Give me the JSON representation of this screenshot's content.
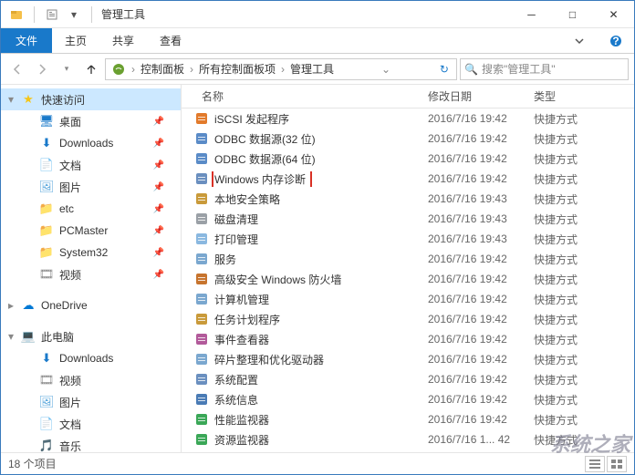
{
  "window": {
    "title": "管理工具",
    "min": "─",
    "max": "□",
    "close": "✕"
  },
  "ribbon": {
    "file": "文件",
    "tabs": [
      "主页",
      "共享",
      "查看"
    ]
  },
  "nav": {
    "history_dd": "▾",
    "up": "↑"
  },
  "breadcrumb": [
    "控制面板",
    "所有控制面板项",
    "管理工具"
  ],
  "search": {
    "placeholder": "搜索\"管理工具\""
  },
  "sidebar": [
    {
      "label": "快速访问",
      "icon": "star",
      "level": 1,
      "active": true,
      "exp": "▾"
    },
    {
      "label": "桌面",
      "icon": "desktop",
      "level": 2,
      "pin": true
    },
    {
      "label": "Downloads",
      "icon": "download",
      "level": 2,
      "pin": true
    },
    {
      "label": "文档",
      "icon": "doc",
      "level": 2,
      "pin": true
    },
    {
      "label": "图片",
      "icon": "pic",
      "level": 2,
      "pin": true
    },
    {
      "label": "etc",
      "icon": "folder",
      "level": 2,
      "pin": true
    },
    {
      "label": "PCMaster",
      "icon": "folder",
      "level": 2,
      "pin": true
    },
    {
      "label": "System32",
      "icon": "folder",
      "level": 2,
      "pin": true
    },
    {
      "label": "视频",
      "icon": "video",
      "level": 2,
      "pin": true
    },
    {
      "label": "",
      "spacer": true
    },
    {
      "label": "OneDrive",
      "icon": "onedrive",
      "level": 1,
      "exp": "▸"
    },
    {
      "label": "",
      "spacer": true
    },
    {
      "label": "此电脑",
      "icon": "pc",
      "level": 1,
      "exp": "▾"
    },
    {
      "label": "Downloads",
      "icon": "download",
      "level": 2
    },
    {
      "label": "视频",
      "icon": "video",
      "level": 2
    },
    {
      "label": "图片",
      "icon": "pic",
      "level": 2
    },
    {
      "label": "文档",
      "icon": "doc",
      "level": 2
    },
    {
      "label": "音乐",
      "icon": "music",
      "level": 2
    }
  ],
  "columns": {
    "name": "名称",
    "date": "修改日期",
    "type": "类型"
  },
  "files": [
    {
      "name": "iSCSI 发起程序",
      "date": "2016/7/16 19:42",
      "type": "快捷方式",
      "icon": "#e27a2b"
    },
    {
      "name": "ODBC 数据源(32 位)",
      "date": "2016/7/16 19:42",
      "type": "快捷方式",
      "icon": "#5a8bc7"
    },
    {
      "name": "ODBC 数据源(64 位)",
      "date": "2016/7/16 19:42",
      "type": "快捷方式",
      "icon": "#5a8bc7"
    },
    {
      "name": "Windows 内存诊断",
      "date": "2016/7/16 19:42",
      "type": "快捷方式",
      "icon": "#6a8fbf",
      "highlight": true
    },
    {
      "name": "本地安全策略",
      "date": "2016/7/16 19:43",
      "type": "快捷方式",
      "icon": "#c99a3a"
    },
    {
      "name": "磁盘清理",
      "date": "2016/7/16 19:43",
      "type": "快捷方式",
      "icon": "#9aa0a6"
    },
    {
      "name": "打印管理",
      "date": "2016/7/16 19:43",
      "type": "快捷方式",
      "icon": "#8ab8e0"
    },
    {
      "name": "服务",
      "date": "2016/7/16 19:42",
      "type": "快捷方式",
      "icon": "#7aa7cf"
    },
    {
      "name": "高级安全 Windows 防火墙",
      "date": "2016/7/16 19:42",
      "type": "快捷方式",
      "icon": "#c7742e"
    },
    {
      "name": "计算机管理",
      "date": "2016/7/16 19:42",
      "type": "快捷方式",
      "icon": "#7aa7cf"
    },
    {
      "name": "任务计划程序",
      "date": "2016/7/16 19:42",
      "type": "快捷方式",
      "icon": "#c99a3a"
    },
    {
      "name": "事件查看器",
      "date": "2016/7/16 19:42",
      "type": "快捷方式",
      "icon": "#b25a9a"
    },
    {
      "name": "碎片整理和优化驱动器",
      "date": "2016/7/16 19:42",
      "type": "快捷方式",
      "icon": "#7aa7cf"
    },
    {
      "name": "系统配置",
      "date": "2016/7/16 19:42",
      "type": "快捷方式",
      "icon": "#6a8fbf"
    },
    {
      "name": "系统信息",
      "date": "2016/7/16 19:42",
      "type": "快捷方式",
      "icon": "#4a7bb5"
    },
    {
      "name": "性能监视器",
      "date": "2016/7/16 19:42",
      "type": "快捷方式",
      "icon": "#3aa757"
    },
    {
      "name": "资源监视器",
      "date": "2016/7/16 1... 42",
      "type": "快捷方式",
      "icon": "#3aa757"
    }
  ],
  "status": {
    "count": "18 个项目"
  },
  "watermark": "系统之家"
}
